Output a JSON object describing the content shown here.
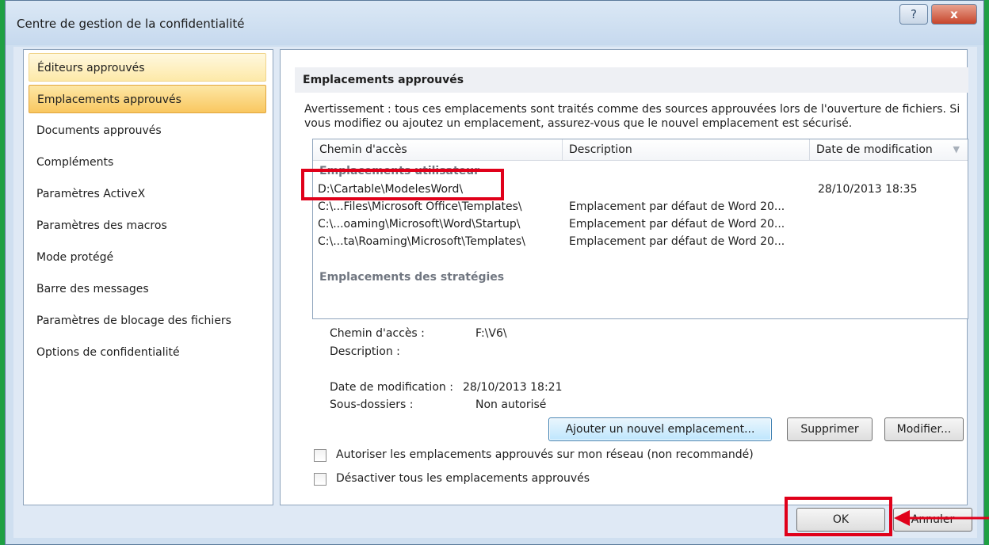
{
  "window": {
    "title": "Centre de gestion de la confidentialité",
    "help_label": "?",
    "close_label": "x"
  },
  "sidebar": {
    "items": [
      {
        "label": "Éditeurs approuvés"
      },
      {
        "label": "Emplacements approuvés"
      },
      {
        "label": "Documents approuvés"
      },
      {
        "label": "Compléments"
      },
      {
        "label": "Paramètres ActiveX"
      },
      {
        "label": "Paramètres des macros"
      },
      {
        "label": "Mode protégé"
      },
      {
        "label": "Barre des messages"
      },
      {
        "label": "Paramètres de blocage des fichiers"
      },
      {
        "label": "Options de confidentialité"
      }
    ]
  },
  "main": {
    "header": "Emplacements approuvés",
    "warning": "Avertissement : tous ces emplacements sont traités comme des sources approuvées lors de l'ouverture de fichiers. Si vous modifiez ou ajoutez un emplacement, assurez-vous que le nouvel emplacement est sécurisé.",
    "columns": {
      "path": "Chemin d'accès",
      "description": "Description",
      "date": "Date de modification"
    },
    "groups": {
      "user": "Emplacements utilisateur",
      "policy": "Emplacements des stratégies"
    },
    "rows": [
      {
        "path": "D:\\Cartable\\ModelesWord\\",
        "description": "",
        "date": "28/10/2013 18:35"
      },
      {
        "path": "C:\\...Files\\Microsoft Office\\Templates\\",
        "description": "Emplacement par défaut de Word 20...",
        "date": ""
      },
      {
        "path": "C:\\...oaming\\Microsoft\\Word\\Startup\\",
        "description": "Emplacement par défaut de Word 20...",
        "date": ""
      },
      {
        "path": "C:\\...ta\\Roaming\\Microsoft\\Templates\\",
        "description": "Emplacement par défaut de Word 20...",
        "date": ""
      }
    ],
    "details": {
      "path_label": "Chemin d'accès :",
      "path_value": "F:\\V6\\",
      "description_label": "Description :",
      "date_label": "Date de modification :",
      "date_value": "28/10/2013 18:21",
      "subfolders_label": "Sous-dossiers :",
      "subfolders_value": "Non autorisé"
    },
    "buttons": {
      "add": "Ajouter un nouvel emplacement...",
      "delete": "Supprimer",
      "modify": "Modifier..."
    },
    "checkboxes": [
      {
        "label": "Autoriser les emplacements approuvés sur mon réseau (non recommandé)",
        "checked": false
      },
      {
        "label": "Désactiver tous les emplacements approuvés",
        "checked": false
      }
    ]
  },
  "footer": {
    "ok": "OK",
    "cancel": "Annuler"
  },
  "colors": {
    "accent_highlight": "#e0001a",
    "background": "#1fa043",
    "selection": "#f9c760"
  }
}
